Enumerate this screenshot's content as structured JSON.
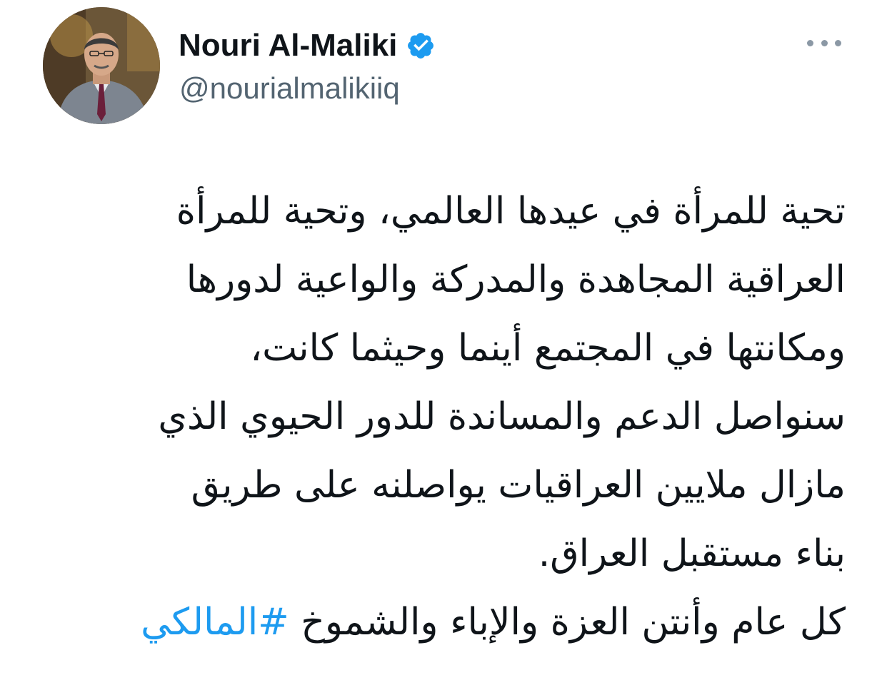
{
  "author": {
    "display_name": "Nouri Al-Maliki",
    "handle": "@nourialmalikiiq",
    "verified": true,
    "avatar_icon": "person-portrait-icon"
  },
  "menu": {
    "icon": "more-options-icon"
  },
  "tweet": {
    "lines": [
      "تحية للمرأة في عيدها العالمي، وتحية للمرأة",
      "العراقية المجاهدة والمدركة والواعية لدورها",
      "ومكانتها في المجتمع أينما وحيثما كانت،",
      "سنواصل الدعم والمساندة للدور الحيوي الذي",
      "مازال ملايين العراقيات يواصلنه على طريق",
      "بناء مستقبل العراق."
    ],
    "last_line_text": "كل عام وأنتن العزة والإباء والشموخ ",
    "hashtag": "#المالكي"
  },
  "colors": {
    "text": "#0f1419",
    "secondary": "#536471",
    "accent": "#1d9bf0"
  }
}
